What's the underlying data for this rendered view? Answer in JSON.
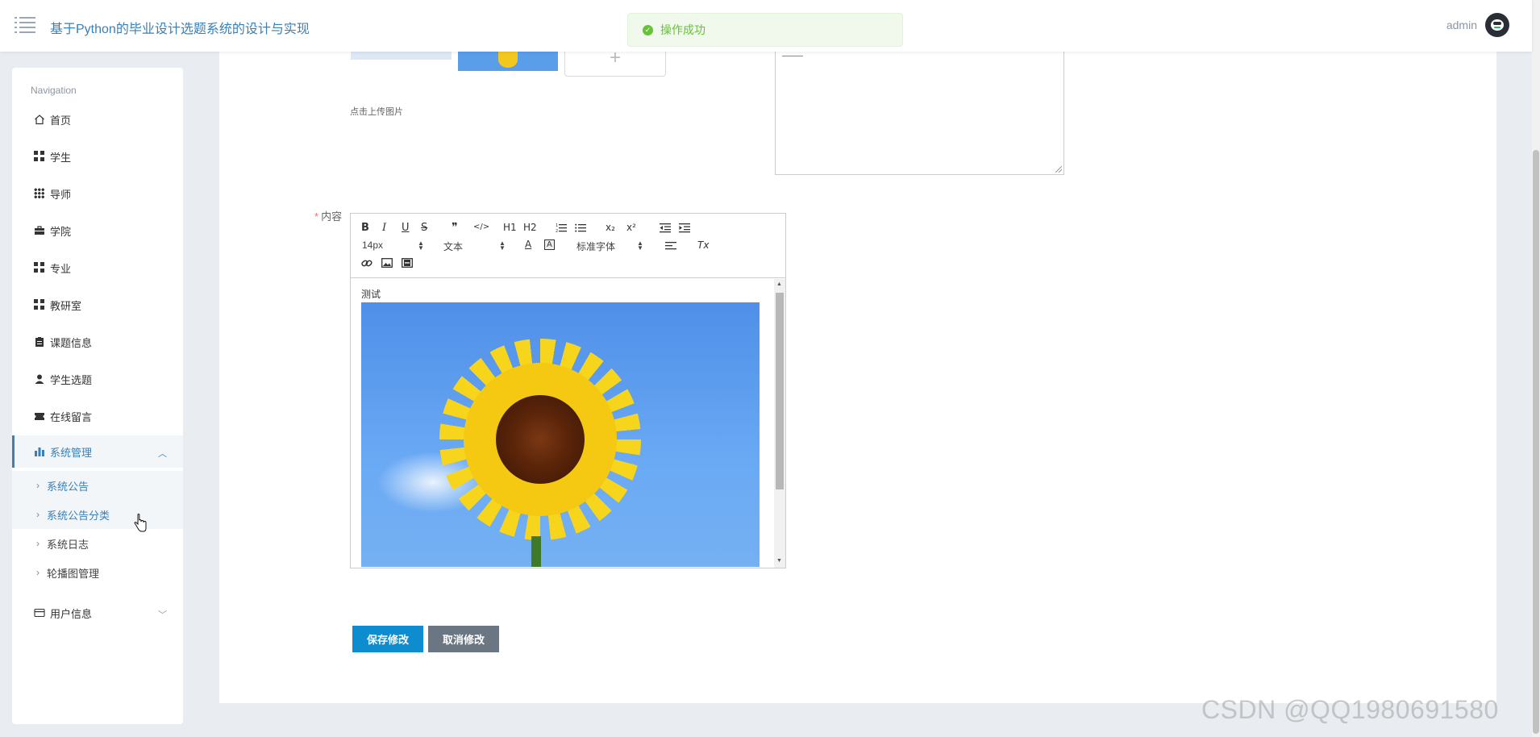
{
  "header": {
    "title": "基于Python的毕业设计选题系统的设计与实现",
    "username": "admin"
  },
  "toast": {
    "message": "操作成功",
    "color": "#67c23a"
  },
  "sidebar": {
    "nav_label": "Navigation",
    "items": [
      {
        "label": "首页",
        "icon": "home-icon"
      },
      {
        "label": "学生",
        "icon": "grid-icon"
      },
      {
        "label": "导师",
        "icon": "grid9-icon"
      },
      {
        "label": "学院",
        "icon": "briefcase-icon"
      },
      {
        "label": "专业",
        "icon": "grid-icon"
      },
      {
        "label": "教研室",
        "icon": "grid-icon"
      },
      {
        "label": "课题信息",
        "icon": "clipboard-icon"
      },
      {
        "label": "学生选题",
        "icon": "user-icon"
      },
      {
        "label": "在线留言",
        "icon": "ticket-icon"
      },
      {
        "label": "系统管理",
        "icon": "bar-chart-icon",
        "expanded": true
      },
      {
        "label": "用户信息",
        "icon": "card-icon",
        "expanded": false
      }
    ],
    "subitems": [
      {
        "label": "系统公告"
      },
      {
        "label": "系统公告分类"
      },
      {
        "label": "系统日志"
      },
      {
        "label": "轮播图管理"
      }
    ],
    "accent": "#3a7fb5"
  },
  "form": {
    "upload_hint": "点击上传图片",
    "content_label": "内容",
    "editor": {
      "font_size": "14px",
      "header_picker": "文本",
      "font_picker": "标准字体",
      "body_text": "测试",
      "toolbar": {
        "bold": "B",
        "italic": "I",
        "underline": "U",
        "strike": "S",
        "blockquote": "❞",
        "code": "</>",
        "h1": "H1",
        "h2": "H2",
        "subscript": "x₂",
        "superscript": "x²",
        "color": "A",
        "background": "A",
        "clean": "Tx"
      }
    },
    "save_label": "保存修改",
    "cancel_label": "取消修改"
  },
  "watermark": "CSDN @QQ1980691580"
}
